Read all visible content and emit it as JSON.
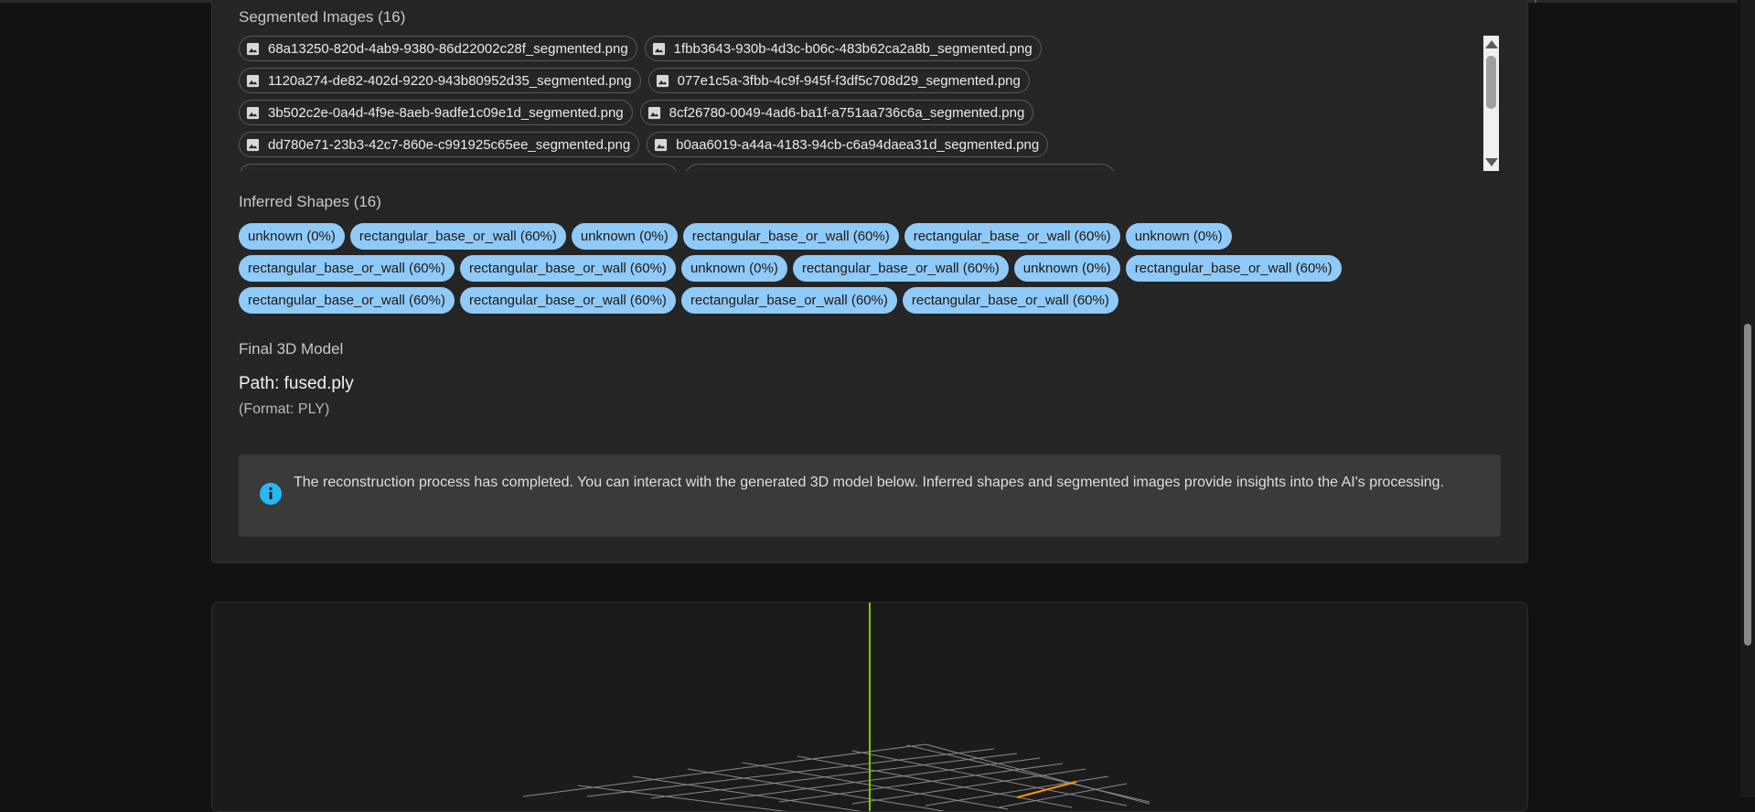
{
  "segmented_images": {
    "title": "Segmented Images (16)",
    "rows": [
      [
        "68a13250-820d-4ab9-9380-86d22002c28f_segmented.png",
        "1fbb3643-930b-4d3c-b06c-483b62ca2a8b_segmented.png"
      ],
      [
        "1120a274-de82-402d-9220-943b80952d35_segmented.png",
        "077e1c5a-3fbb-4c9f-945f-f3df5c708d29_segmented.png"
      ],
      [
        "3b502c2e-0a4d-4f9e-8aeb-9adfe1c09e1d_segmented.png",
        "8cf26780-0049-4ad6-ba1f-a751aa736c6a_segmented.png"
      ],
      [
        "dd780e71-23b3-42c7-860e-c991925c65ee_segmented.png",
        "b0aa6019-a44a-4183-94cb-c6a94daea31d_segmented.png"
      ],
      [
        "",
        ""
      ]
    ]
  },
  "inferred_shapes": {
    "title": "Inferred Shapes (16)",
    "rows": [
      [
        "unknown (0%)",
        "rectangular_base_or_wall (60%)",
        "unknown (0%)",
        "rectangular_base_or_wall (60%)",
        "rectangular_base_or_wall (60%)",
        "unknown (0%)"
      ],
      [
        "rectangular_base_or_wall (60%)",
        "rectangular_base_or_wall (60%)",
        "unknown (0%)",
        "rectangular_base_or_wall (60%)",
        "unknown (0%)",
        "rectangular_base_or_wall (60%)"
      ],
      [
        "rectangular_base_or_wall (60%)",
        "rectangular_base_or_wall (60%)",
        "rectangular_base_or_wall (60%)",
        "rectangular_base_or_wall (60%)"
      ]
    ]
  },
  "final_model": {
    "title": "Final 3D Model",
    "path": "Path: fused.ply",
    "format": "(Format: PLY)"
  },
  "alert": {
    "icon": "info-icon",
    "message": "The reconstruction process has completed. You can interact with the generated 3D model below. Inferred shapes and segmented images provide insights into the AI's processing."
  },
  "colors": {
    "chip_blue": "#90caf9",
    "info_blue": "#29b6f6",
    "axis_green": "#6cd400",
    "axis_orange": "#ff9800"
  }
}
